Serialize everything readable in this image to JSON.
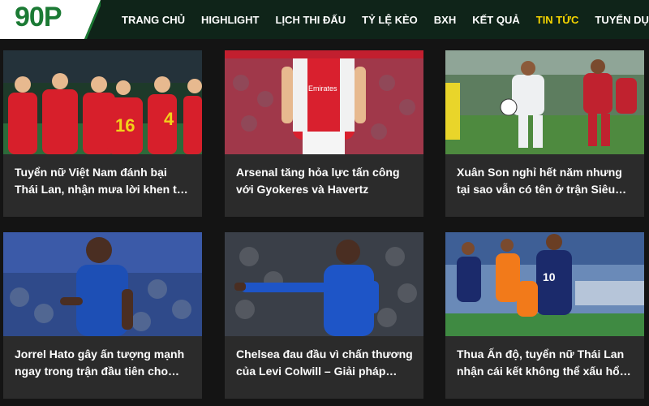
{
  "brand": {
    "logo_text": "90P",
    "logo_color": "#1b7a34",
    "header_bg": "#0f2419",
    "active_color": "#f5d400"
  },
  "nav": {
    "items": [
      {
        "label": "TRANG CHỦ"
      },
      {
        "label": "HIGHLIGHT"
      },
      {
        "label": "LỊCH THI ĐẤU"
      },
      {
        "label": "TỶ LỆ KÈO"
      },
      {
        "label": "BXH"
      },
      {
        "label": "KẾT QUẢ"
      },
      {
        "label": "TIN TỨC",
        "active": true
      },
      {
        "label": "TUYỂN DỤNG"
      }
    ]
  },
  "articles": [
    {
      "title": "Tuyển nữ Việt Nam đánh bại Thái Lan, nhận mưa lời khen từ CĐV k…",
      "image": "vietnam-women-team-celebration"
    },
    {
      "title": "Arsenal tăng hỏa lực tấn công với Gyokeres và Havertz",
      "image": "arsenal-player"
    },
    {
      "title": "Xuân Son nghỉ hết năm nhưng tại sao vẫn có tên ở trận Siêu cúp…",
      "image": "match-action"
    },
    {
      "title": "Jorrel Hato gây ấn tượng mạnh ngay trong trận đầu tiên cho…",
      "image": "chelsea-player-hato"
    },
    {
      "title": "Chelsea đau đầu vì chấn thương của Levi Colwill – Giải pháp nào…",
      "image": "chelsea-player-pointing"
    },
    {
      "title": "Thua Ấn độ, tuyển nữ Thái Lan nhận cái kết không thể xấu hổ hơn",
      "image": "thailand-women-match"
    }
  ]
}
